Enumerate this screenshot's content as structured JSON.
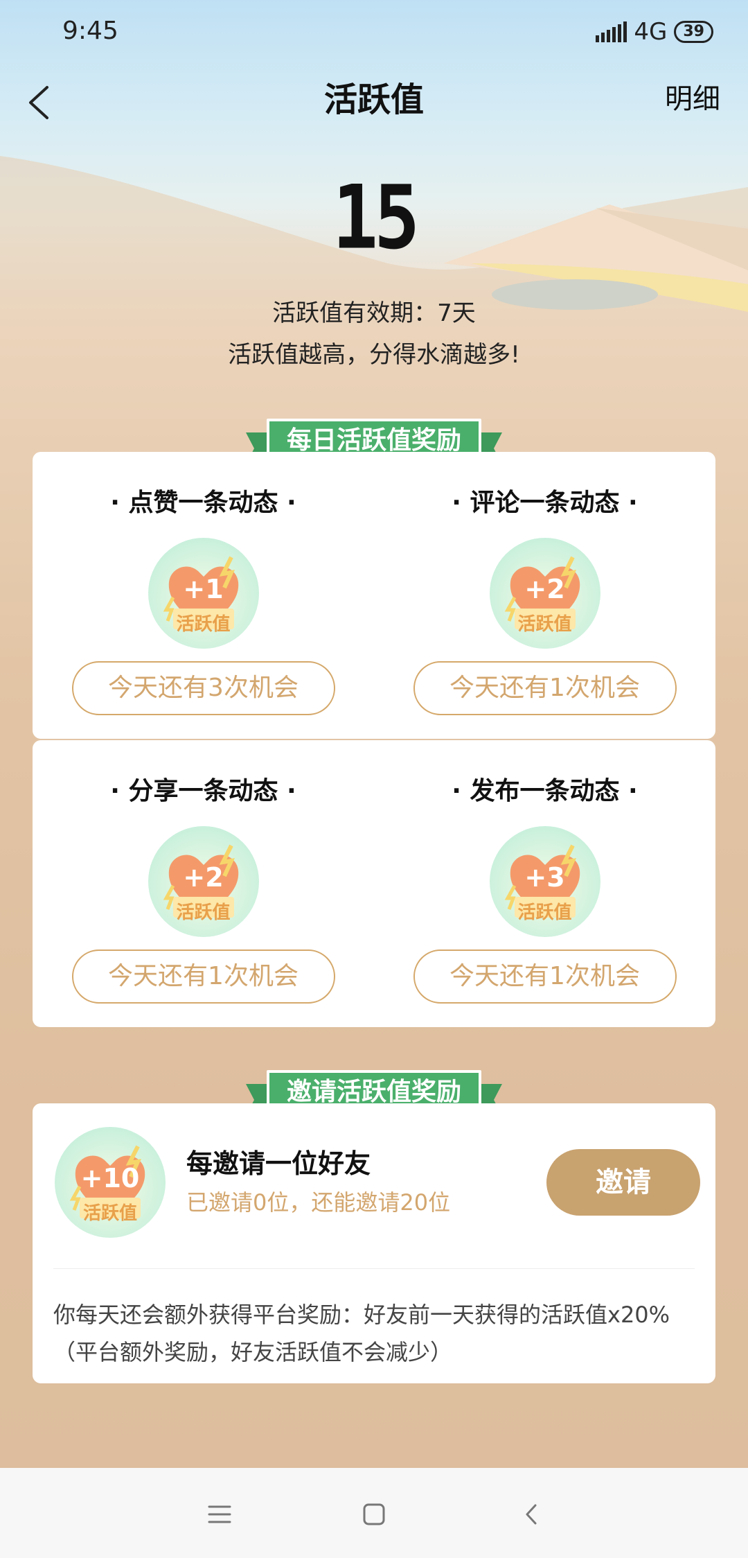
{
  "status_bar": {
    "time": "9:45",
    "network": "4G",
    "battery": "39"
  },
  "header": {
    "title": "活跃值",
    "detail": "明细"
  },
  "score": {
    "value": "15",
    "validity": "活跃值有效期：7天",
    "tip": "活跃值越高，分得水滴越多!"
  },
  "daily": {
    "ribbon": "每日活跃值奖励",
    "tasks": [
      {
        "name": "· 点赞一条动态 ·",
        "plus": "+1",
        "tag": "活跃值",
        "chance": "今天还有3次机会"
      },
      {
        "name": "· 评论一条动态 ·",
        "plus": "+2",
        "tag": "活跃值",
        "chance": "今天还有1次机会"
      },
      {
        "name": "· 分享一条动态 ·",
        "plus": "+2",
        "tag": "活跃值",
        "chance": "今天还有1次机会"
      },
      {
        "name": "· 发布一条动态 ·",
        "plus": "+3",
        "tag": "活跃值",
        "chance": "今天还有1次机会"
      }
    ]
  },
  "invite": {
    "ribbon": "邀请活跃值奖励",
    "plus": "+10",
    "tag": "活跃值",
    "title": "每邀请一位好友",
    "subtitle": "已邀请0位，还能邀请20位",
    "button": "邀请",
    "note": "你每天还会额外获得平台奖励：好友前一天获得的活跃值x20%（平台额外奖励，好友活跃值不会减少）"
  },
  "colors": {
    "green": "#4aaf6b",
    "gold": "#c8a26f",
    "chance_text": "#d3a66e"
  },
  "icons": [
    "back-chevron-icon",
    "heart-lightning-icon",
    "menu-icon",
    "home-square-icon",
    "back-triangle-icon"
  ]
}
